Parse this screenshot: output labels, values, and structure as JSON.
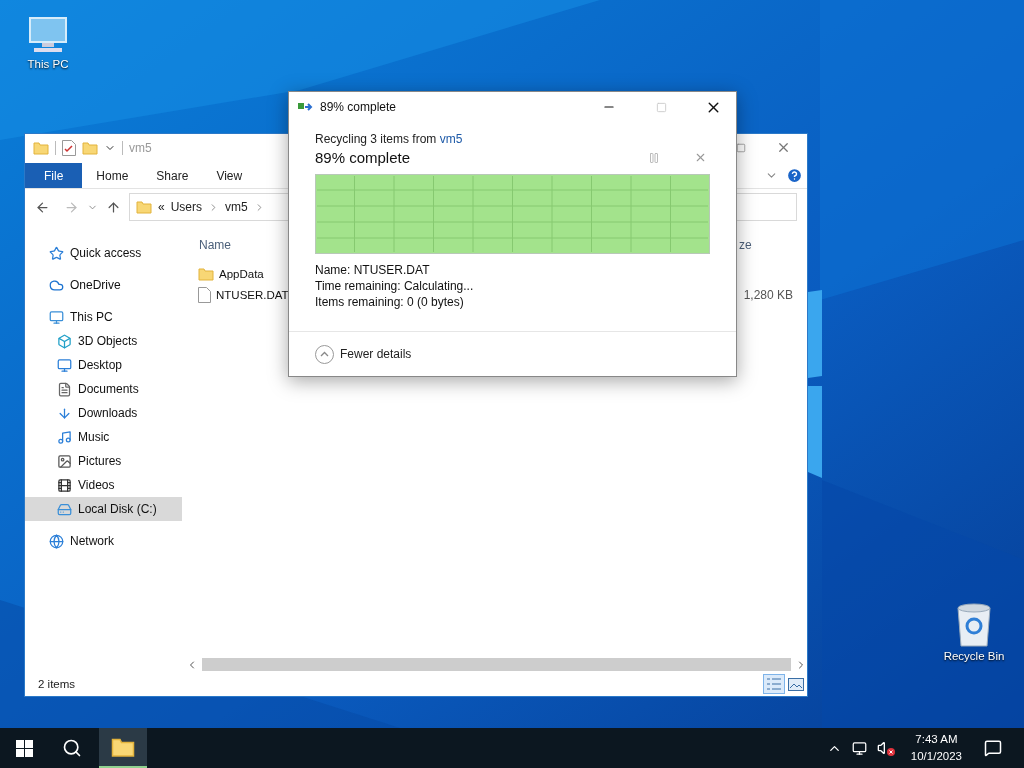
{
  "desktop_icons": [
    {
      "label": "This PC",
      "kind": "pc"
    },
    {
      "label": "Recycle Bin",
      "kind": "bin"
    }
  ],
  "explorer": {
    "title": "vm5",
    "ribbon_tabs": [
      {
        "label": "File",
        "selected": true
      },
      {
        "label": "Home",
        "selected": false
      },
      {
        "label": "Share",
        "selected": false
      },
      {
        "label": "View",
        "selected": false
      }
    ],
    "breadcrumb": {
      "overflow": "«",
      "parts": [
        "Users",
        "vm5"
      ]
    },
    "nav": [
      {
        "label": "Quick access",
        "kind": "star",
        "selected": false
      },
      {
        "label": "OneDrive",
        "kind": "cloud",
        "selected": false
      },
      {
        "label": "This PC",
        "kind": "pc",
        "selected": false,
        "children": [
          {
            "label": "3D Objects",
            "kind": "cube",
            "selected": false
          },
          {
            "label": "Desktop",
            "kind": "desktop",
            "selected": false
          },
          {
            "label": "Documents",
            "kind": "documents",
            "selected": false
          },
          {
            "label": "Downloads",
            "kind": "downloads",
            "selected": false
          },
          {
            "label": "Music",
            "kind": "music",
            "selected": false
          },
          {
            "label": "Pictures",
            "kind": "pictures",
            "selected": false
          },
          {
            "label": "Videos",
            "kind": "videos",
            "selected": false
          },
          {
            "label": "Local Disk (C:)",
            "kind": "disk",
            "selected": true
          }
        ]
      },
      {
        "label": "Network",
        "kind": "network",
        "selected": false
      }
    ],
    "columns": [
      "Name",
      "ze"
    ],
    "files": [
      {
        "name": "AppData",
        "kind": "folder"
      },
      {
        "name": "NTUSER.DAT",
        "kind": "file",
        "size": "1,280 KB"
      }
    ],
    "status": "2 items",
    "views": [
      {
        "kind": "details",
        "selected": true
      },
      {
        "kind": "tiles",
        "selected": false
      }
    ]
  },
  "dialog": {
    "title": "89% complete",
    "message": "Recycling 3 items from",
    "source_link": "vm5",
    "progress_text": "89% complete",
    "details": [
      "Name:  NTUSER.DAT",
      "Time remaining:  Calculating...",
      "Items remaining:  0 (0 bytes)"
    ],
    "toggle": {
      "label": "Fewer details",
      "expanded": true
    }
  },
  "taskbar": {
    "apps": [
      {
        "kind": "explorer",
        "selected": true
      }
    ],
    "time": "7:43 AM",
    "date": "10/1/2023",
    "muted": true
  }
}
